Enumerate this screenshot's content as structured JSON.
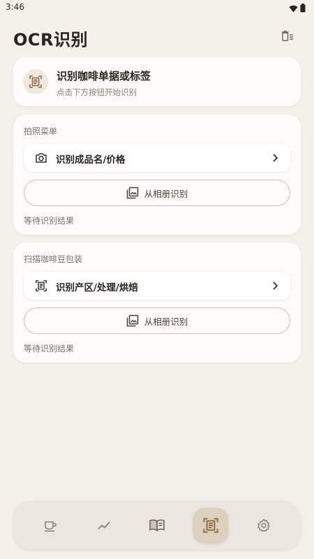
{
  "status_bar": {
    "time": "3:46",
    "wifi_icon": "wifi-icon",
    "battery_icon": "battery-icon"
  },
  "header": {
    "title": "OCR识别",
    "clear_icon": "clear-all-icon"
  },
  "hero": {
    "title": "识别咖啡单据或标签",
    "subtitle": "点击下方按钮开始识别",
    "icon": "document-scanner-icon"
  },
  "sections": [
    {
      "label": "拍照菜单",
      "action": {
        "label": "识别成品名/价格",
        "icon": "camera-icon"
      },
      "album_button": "从相册识别",
      "result": "等待识别结果"
    },
    {
      "label": "扫描咖啡豆包装",
      "action": {
        "label": "识别产区/处理/烘焙",
        "icon": "document-scanner-icon"
      },
      "album_button": "从相册识别",
      "result": "等待识别结果"
    }
  ],
  "bottom_nav": {
    "items": [
      {
        "name": "coffee",
        "icon": "coffee-cup-icon"
      },
      {
        "name": "trends",
        "icon": "trend-line-icon"
      },
      {
        "name": "notes",
        "icon": "book-icon"
      },
      {
        "name": "ocr",
        "icon": "document-scanner-icon",
        "active": true
      },
      {
        "name": "settings",
        "icon": "gear-icon"
      }
    ]
  },
  "colors": {
    "background": "#f4f0ea",
    "card": "#fdfcfb",
    "accent": "#8a6a44",
    "nav_active": "#ddd0c0",
    "text": "#2a241f",
    "muted": "#7a726a"
  }
}
